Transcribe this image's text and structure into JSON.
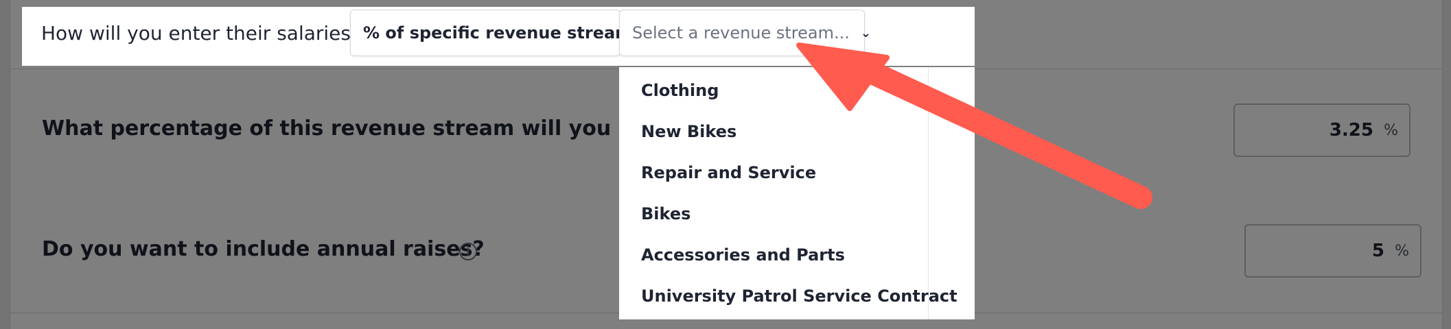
{
  "salary_question": {
    "label": "How will you enter their salaries?",
    "method_select": {
      "value": "% of specific revenue stream"
    },
    "stream_select": {
      "placeholder": "Select a revenue stream..."
    }
  },
  "revenue_streams": [
    "Clothing",
    "New Bikes",
    "Repair and Service",
    "Bikes",
    "Accessories and Parts",
    "University Patrol Service Contract"
  ],
  "percentage_question": {
    "label": "What percentage of this revenue stream will you pay p",
    "value": "3.25",
    "unit": "%"
  },
  "raises_question": {
    "label": "Do you want to include annual raises?",
    "info_glyph": "i",
    "value": "5",
    "unit": "%"
  },
  "colors": {
    "arrow": "#ff5b4e",
    "overlay": "rgba(0,0,0,0.5)",
    "text_primary": "#1f2433",
    "text_muted": "#6b7280"
  },
  "icons": {
    "dropdown": "chevron-down-icon",
    "info": "info-icon",
    "pointer": "red-arrow-annotation"
  }
}
